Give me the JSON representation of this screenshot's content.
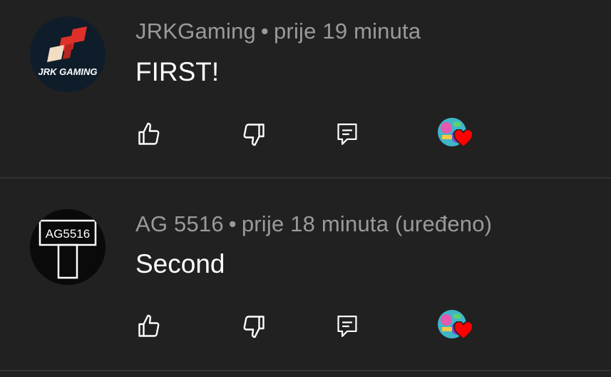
{
  "comments": [
    {
      "author": "JRKGaming",
      "separator": "•",
      "time": "prije 19 minuta",
      "text": "FIRST!",
      "avatar_text": "JRK GAMING",
      "avatar_icon": "jrk-gaming-logo"
    },
    {
      "author": "AG 5516",
      "separator": "•",
      "time": "prije 18 minuta (uređeno)",
      "text": "Second",
      "avatar_text": "AG5516",
      "avatar_icon": "sign-board-logo"
    }
  ],
  "actions": {
    "like_icon": "thumb-up-icon",
    "dislike_icon": "thumb-down-icon",
    "reply_icon": "reply-comment-icon",
    "creator_heart_icon": "creator-heart-icon"
  },
  "colors": {
    "background": "#212121",
    "meta": "#9a9a9a",
    "text": "#ffffff",
    "heart": "#ff0000",
    "divider": "#333333"
  }
}
